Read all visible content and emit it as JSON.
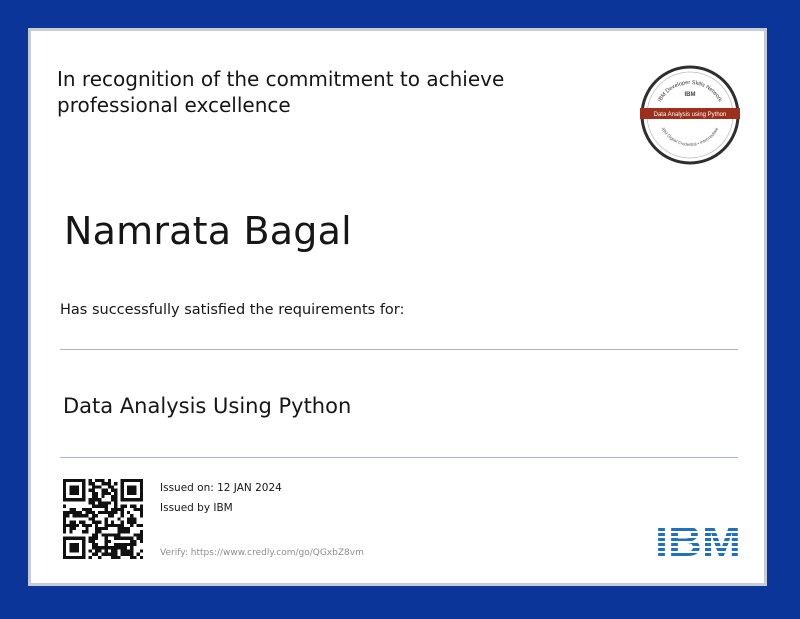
{
  "certificate": {
    "recognition_line1": "In recognition of the commitment to achieve",
    "recognition_line2": "professional excellence",
    "recipient_name": "Namrata Bagal",
    "requirement_text": "Has successfully satisfied the requirements for:",
    "course_title": "Data Analysis Using Python",
    "issued_on": "Issued on: 12 JAN 2024",
    "issued_by": "Issued by IBM",
    "verify": "Verify: https://www.credly.com/go/QGxbZ8vm"
  },
  "badge": {
    "top_text": "IBM Developer Skills Network",
    "brand": "IBM",
    "title": "Data Analysis using Python",
    "bottom_text": "IBM Digital Credential • Intermediate",
    "ribbon_color": "#9e2f1c"
  },
  "logo": {
    "text": "IBM",
    "color": "#1f70c1"
  },
  "colors": {
    "frame": "#0b3598",
    "border": "#c7cbd6",
    "rule": "#a9b3c6"
  }
}
